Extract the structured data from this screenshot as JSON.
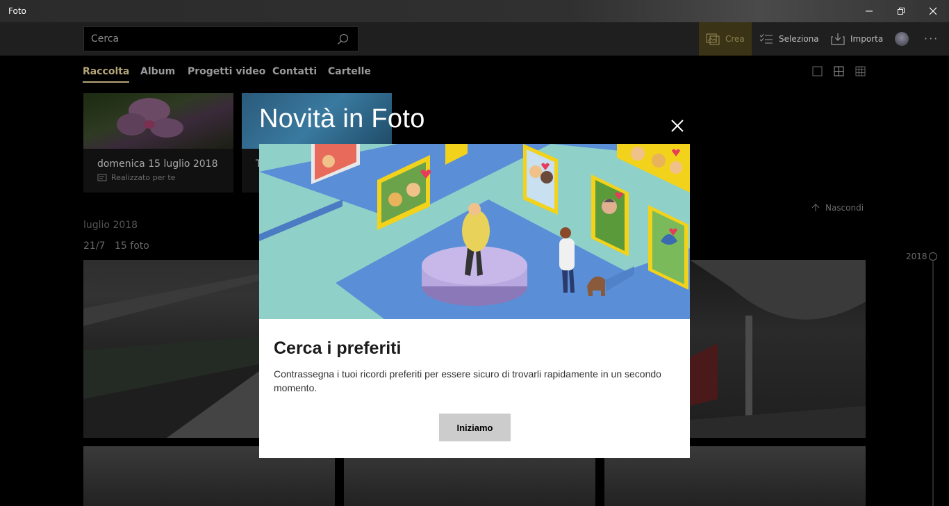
{
  "window": {
    "title": "Foto"
  },
  "search": {
    "placeholder": "Cerca"
  },
  "toolbar": {
    "crea": "Crea",
    "seleziona": "Seleziona",
    "importa": "Importa"
  },
  "nav": {
    "tabs": [
      "Raccolta",
      "Album",
      "Progetti video",
      "Contatti",
      "Cartelle"
    ],
    "active": "Raccolta"
  },
  "content": {
    "card1_title": "domenica 15 luglio 2018",
    "card1_sub": "Realizzato per te",
    "card2_partial": "T",
    "hide_label": "Nascondi",
    "month_label": "luglio 2018",
    "date_label": "21/7",
    "count_label": "15 foto",
    "timeline_year": "2018"
  },
  "dialog": {
    "title": "Novità in Foto",
    "heading": "Cerca i preferiti",
    "body": "Contrassegna i tuoi ricordi preferiti per essere sicuro di trovarli rapidamente in un secondo momento.",
    "button": "Iniziamo"
  },
  "colors": {
    "accent": "#b5a57a",
    "crea_bg": "#3a3316"
  }
}
